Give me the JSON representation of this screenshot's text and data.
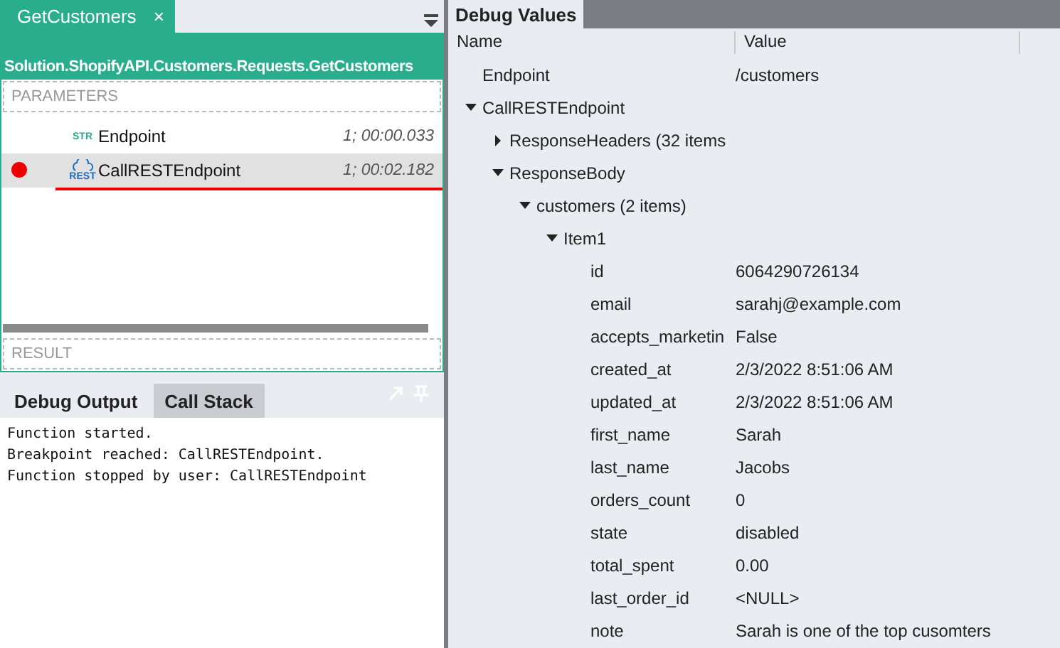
{
  "editor": {
    "tab": {
      "label": "GetCustomers",
      "close": "×",
      "selected": true
    },
    "path": "Solution.ShopifyAPI.Customers.Requests.GetCustomers",
    "parameters_label": "PARAMETERS",
    "steps": [
      {
        "kind": "str",
        "badge": "STR",
        "name": "Endpoint",
        "timing": "1; 00:00.033",
        "breakpoint": false,
        "selected": false
      },
      {
        "kind": "rest",
        "badge": "REST",
        "name": "CallRESTEndpoint",
        "timing": "1; 00:02.182",
        "breakpoint": true,
        "selected": true
      }
    ],
    "result_label": "RESULT"
  },
  "output": {
    "tabs": [
      {
        "label": "Debug Output",
        "selected": true
      },
      {
        "label": "Call Stack",
        "selected": false
      }
    ],
    "lines": [
      "Function started.",
      "Breakpoint reached: CallRESTEndpoint.",
      "Function stopped by user: CallRESTEndpoint"
    ]
  },
  "debug_values": {
    "title": "Debug Values",
    "columns": [
      "Name",
      "Value"
    ],
    "tree": [
      {
        "name": "Endpoint",
        "value": "/customers"
      },
      {
        "name": "CallRESTEndpoint",
        "expanded": true,
        "children": [
          {
            "name": "ResponseHeaders (32 items",
            "expanded": false
          },
          {
            "name": "ResponseBody",
            "expanded": true,
            "children": [
              {
                "name": "customers (2 items)",
                "expanded": true,
                "children": [
                  {
                    "name": "Item1",
                    "expanded": true,
                    "children": [
                      {
                        "name": "id",
                        "value": "6064290726134"
                      },
                      {
                        "name": "email",
                        "value": "sarahj@example.com"
                      },
                      {
                        "name": "accepts_marketin",
                        "value": "False"
                      },
                      {
                        "name": "created_at",
                        "value": "2/3/2022 8:51:06 AM"
                      },
                      {
                        "name": "updated_at",
                        "value": "2/3/2022 8:51:06 AM"
                      },
                      {
                        "name": "first_name",
                        "value": "Sarah"
                      },
                      {
                        "name": "last_name",
                        "value": "Jacobs"
                      },
                      {
                        "name": "orders_count",
                        "value": "0"
                      },
                      {
                        "name": "state",
                        "value": "disabled"
                      },
                      {
                        "name": "total_spent",
                        "value": "0.00"
                      },
                      {
                        "name": "last_order_id",
                        "value": "<NULL>"
                      },
                      {
                        "name": "note",
                        "value": "Sarah is one of the top cusomters"
                      }
                    ]
                  }
                ]
              }
            ]
          }
        ]
      }
    ]
  }
}
